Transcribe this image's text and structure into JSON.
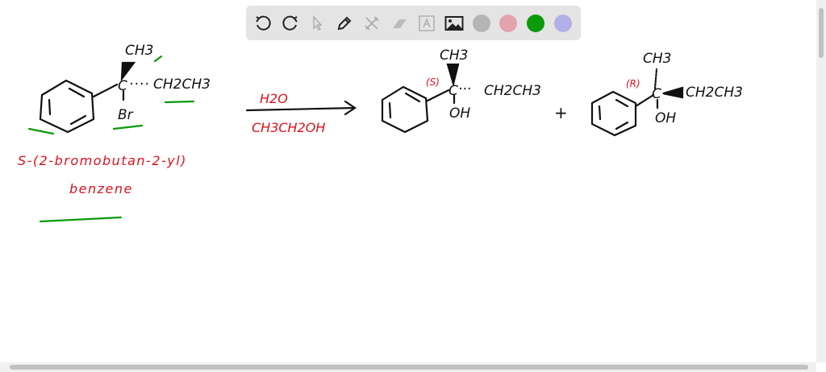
{
  "toolbar": {
    "tools": [
      "undo-icon",
      "redo-icon",
      "select-icon",
      "pen-icon",
      "tools-icon",
      "eraser-icon",
      "text-icon",
      "image-icon"
    ],
    "colors": [
      "#b5b5b5",
      "#e2a3ad",
      "#0a9a0a",
      "#b3b0e8"
    ]
  },
  "reactant": {
    "methyl": "CH3",
    "ethyl": "CH2CH3",
    "carbon": "C",
    "leaving_group": "Br",
    "name_line1": "S-(2-bromobutan-2-yl)",
    "name_line2": "benzene"
  },
  "conditions": {
    "above": "H2O",
    "below": "CH3CH2OH"
  },
  "product_s": {
    "label": "(S)",
    "carbon": "C",
    "methyl": "CH3",
    "ethyl": "CH2CH3",
    "hydroxyl": "OH"
  },
  "plus": "+",
  "product_r": {
    "label": "(R)",
    "carbon": "C",
    "methyl": "CH3",
    "ethyl": "CH2CH3",
    "hydroxyl": "OH"
  }
}
